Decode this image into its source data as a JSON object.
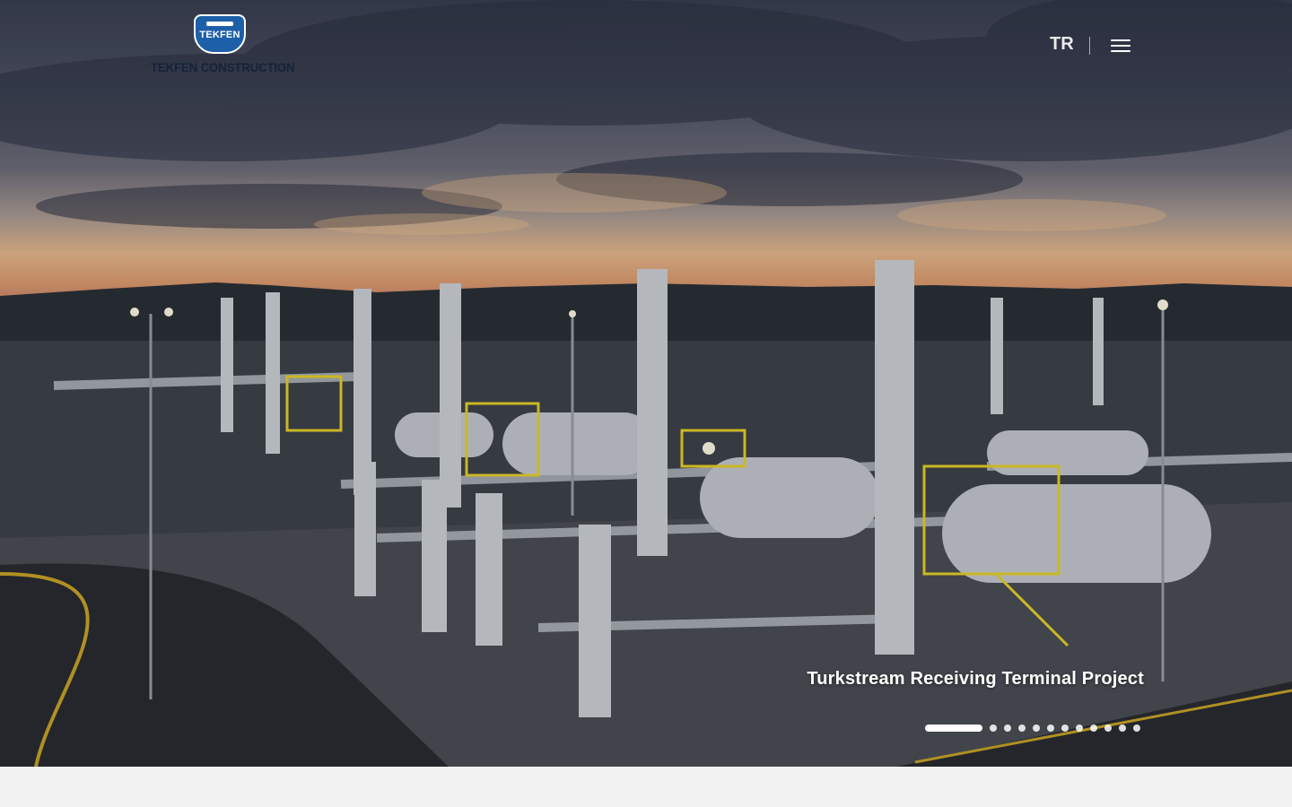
{
  "header": {
    "logo": {
      "mark_text": "TEKFEN",
      "wordmark": "TEKFEN CONSTRUCTION"
    },
    "language_toggle": "TR",
    "menu_icon": "hamburger-menu-icon"
  },
  "hero": {
    "caption": "Turkstream Receiving Terminal Project",
    "slider": {
      "total_slides": 12,
      "active_index": 0
    }
  },
  "colors": {
    "logo_blue": "#1d5fa8",
    "wordmark": "#14233a",
    "bottom_band": "#f2f2f2"
  }
}
